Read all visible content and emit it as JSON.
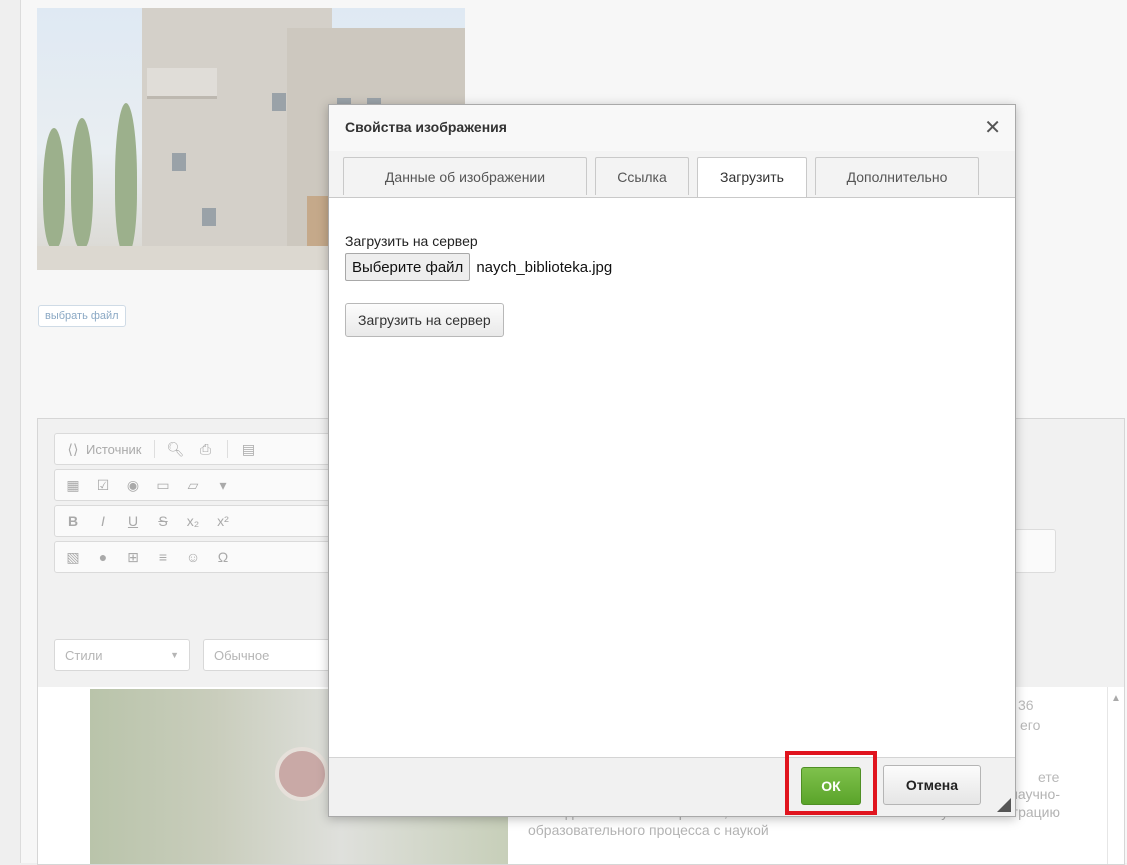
{
  "background": {
    "pick_file_link": "выбрать файл",
    "toolbar": {
      "source_label": "Источник",
      "styles_combo": "Стили",
      "format_combo": "Обычное"
    },
    "content": {
      "frag_number": "36",
      "frag_word": "его",
      "frag_tail": "ете",
      "paragraph": "сложилась определенная система привлечения студентов к научно-исследовательской работе, что обеспечивает тесную интеграцию образовательного процесса с наукой"
    }
  },
  "dialog": {
    "title": "Свойства изображения",
    "tabs": [
      {
        "label": "Данные об изображении",
        "active": false
      },
      {
        "label": "Ссылка",
        "active": false
      },
      {
        "label": "Загрузить",
        "active": true
      },
      {
        "label": "Дополнительно",
        "active": false
      }
    ],
    "upload": {
      "label": "Загрузить на сервер",
      "choose_file_button": "Выберите файл",
      "file_name": "naych_biblioteka.jpg",
      "upload_button": "Загрузить на сервер"
    },
    "footer": {
      "ok_label": "ОК",
      "cancel_label": "Отмена"
    }
  }
}
